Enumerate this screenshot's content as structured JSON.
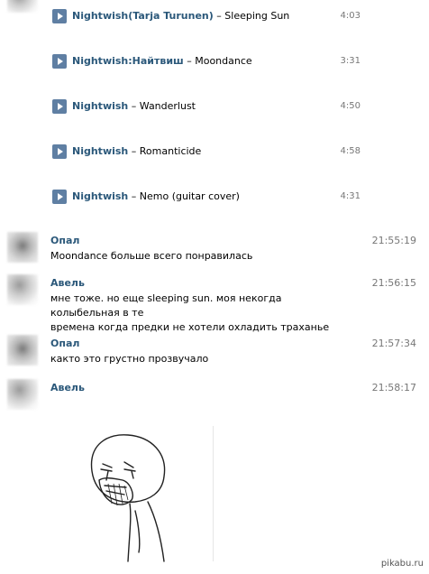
{
  "tracks": [
    {
      "artist": "Nightwish(Tarja Turunen)",
      "separator": " – ",
      "title": "Sleeping Sun",
      "duration": "4:03"
    },
    {
      "artist": "Nightwish:Найтвиш",
      "separator": " – ",
      "title": "Moondance",
      "duration": "3:31"
    },
    {
      "artist": "Nightwish",
      "separator": " – ",
      "title": "Wanderlust",
      "duration": "4:50"
    },
    {
      "artist": "Nightwish",
      "separator": " – ",
      "title": "Romanticide",
      "duration": "4:58"
    },
    {
      "artist": "Nightwish",
      "separator": " – ",
      "title": "Nemo (guitar cover)",
      "duration": "4:31"
    }
  ],
  "messages": [
    {
      "author": "Опал",
      "time": "21:55:19",
      "lines": [
        "Moondance больше всего понравилась"
      ]
    },
    {
      "author": "Авель",
      "time": "21:56:15",
      "lines": [
        "мне тоже. но еще sleeping sun. моя некогда колыбельная в те",
        "времена когда предки не хотели охладить траханье"
      ]
    },
    {
      "author": "Опал",
      "time": "21:57:34",
      "lines": [
        "както это грустно прозвучало"
      ]
    },
    {
      "author": "Авель",
      "time": "21:58:17",
      "lines": []
    }
  ],
  "icons": {
    "play": "play-icon",
    "avatar": "avatar-icon"
  },
  "colors": {
    "link": "#2b587a",
    "play_button": "#5f7fa3",
    "time": "#777777"
  },
  "watermark": "pikabu.ru"
}
